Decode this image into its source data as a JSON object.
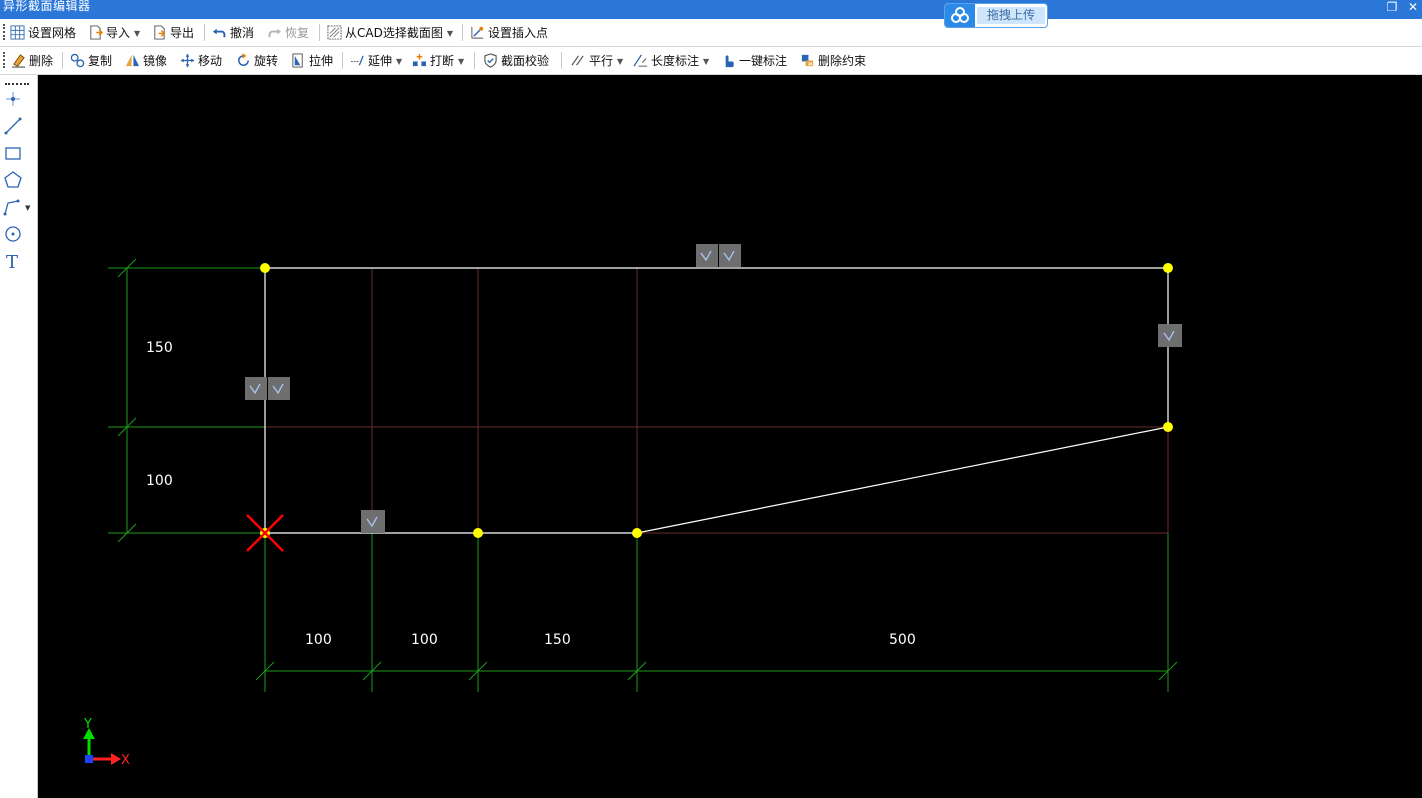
{
  "window": {
    "title": "异形截面编辑器",
    "restore_icon": "restore-icon",
    "close_icon": "close-icon"
  },
  "upload_widget": {
    "icon": "baidu-cloud-icon",
    "label": "拖拽上传"
  },
  "toolbar1": [
    {
      "key": "grid",
      "label": "设置网格",
      "icon": "grid-icon"
    },
    {
      "key": "import",
      "label": "导入",
      "icon": "import-icon",
      "dropdown": true
    },
    {
      "key": "export",
      "label": "导出",
      "icon": "export-icon"
    },
    {
      "key": "undo",
      "label": "撤消",
      "icon": "undo-icon"
    },
    {
      "key": "redo",
      "label": "恢复",
      "icon": "redo-icon",
      "disabled": true
    },
    {
      "key": "cad",
      "label": "从CAD选择截面图",
      "icon": "cad-select-icon",
      "dropdown": true
    },
    {
      "key": "insert",
      "label": "设置插入点",
      "icon": "insert-point-icon"
    }
  ],
  "toolbar2": [
    {
      "key": "delete",
      "label": "删除",
      "icon": "eraser-icon"
    },
    {
      "key": "copy",
      "label": "复制",
      "icon": "copy-icon"
    },
    {
      "key": "mirror",
      "label": "镜像",
      "icon": "mirror-icon"
    },
    {
      "key": "move",
      "label": "移动",
      "icon": "move-icon"
    },
    {
      "key": "rotate",
      "label": "旋转",
      "icon": "rotate-icon"
    },
    {
      "key": "stretch",
      "label": "拉伸",
      "icon": "stretch-icon"
    },
    {
      "key": "extend",
      "label": "延伸",
      "icon": "extend-icon",
      "dropdown": true
    },
    {
      "key": "break",
      "label": "打断",
      "icon": "break-icon",
      "dropdown": true
    },
    {
      "key": "check",
      "label": "截面校验",
      "icon": "shield-check-icon"
    },
    {
      "key": "parallel",
      "label": "平行",
      "icon": "parallel-icon",
      "dropdown": true
    },
    {
      "key": "length",
      "label": "长度标注",
      "icon": "length-dim-icon",
      "dropdown": true
    },
    {
      "key": "auto",
      "label": "一键标注",
      "icon": "hand-dim-icon"
    },
    {
      "key": "delconstraint",
      "label": "删除约束",
      "icon": "delete-constraint-icon"
    }
  ],
  "left_tools": [
    "point-icon",
    "line-icon",
    "rectangle-icon",
    "polygon-icon",
    "polyline-icon",
    "circle-icon",
    "text-icon"
  ],
  "left_tool_text_glyph": "T",
  "canvas": {
    "dims_horizontal": [
      "100",
      "100",
      "150",
      "500"
    ],
    "dims_vertical": [
      "150",
      "100"
    ],
    "axis": {
      "x": "X",
      "y": "Y"
    },
    "colors": {
      "background": "#000000",
      "outline": "#ffffff",
      "vertex": "#ffff00",
      "grid": "#6b2a2a",
      "dimension": "#1e9a1e",
      "origin_marker": "#ff0000",
      "constraint_badge": "#6e6e6e"
    }
  }
}
